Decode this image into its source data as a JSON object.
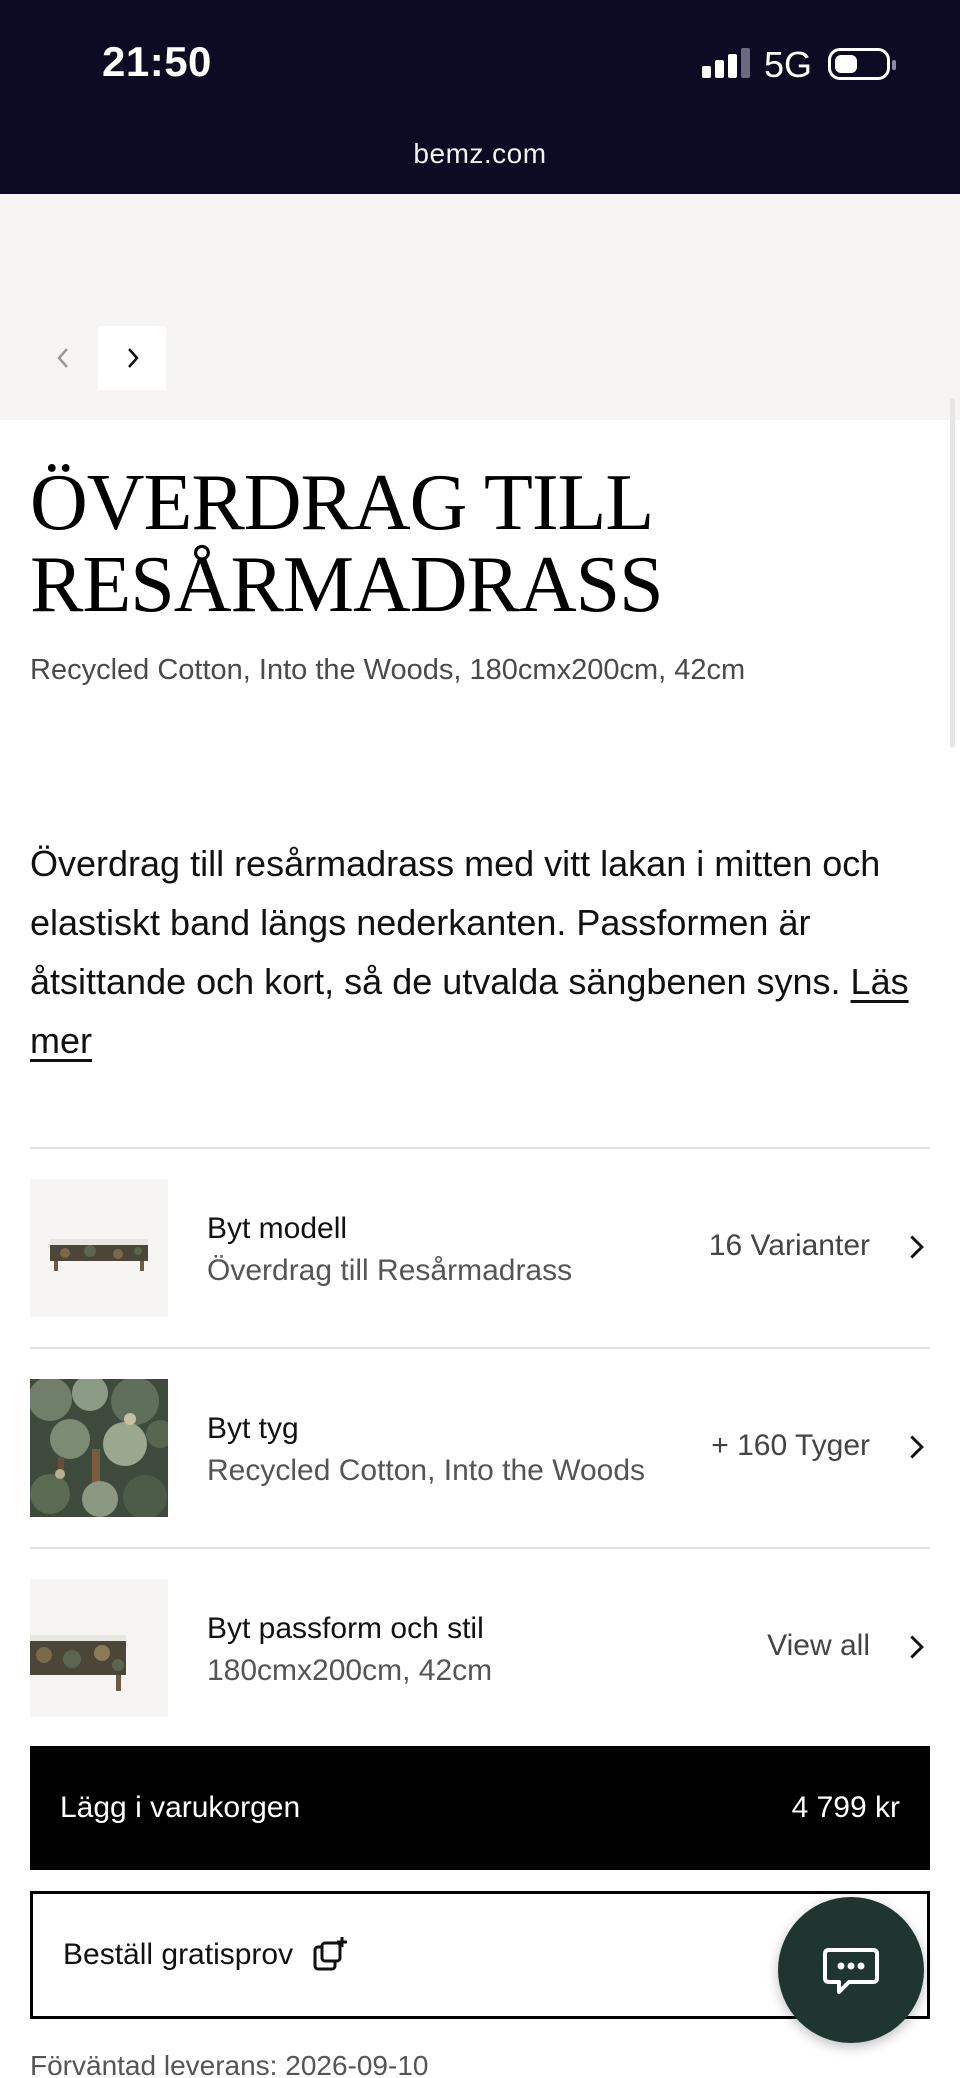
{
  "status_bar": {
    "time": "21:50",
    "network": "5G",
    "url": "bemz.com"
  },
  "gallery": {
    "prev_icon": "chevron-left-icon",
    "next_icon": "chevron-right-icon"
  },
  "product": {
    "title": "ÖVERDRAG TILL RESÅRMADRASS",
    "subtitle": "Recycled Cotton, Into the Woods, 180cmx200cm, 42cm",
    "description": "Överdrag till resårmadrass med vitt lakan i mitten och elastiskt band längs nederkanten. Passformen är åtsittande och kort, så de utvalda sängbenen syns.",
    "read_more": "Läs mer"
  },
  "options": [
    {
      "title": "Byt modell",
      "value": "Överdrag till Resårmadrass",
      "meta": "16 Varianter"
    },
    {
      "title": "Byt tyg",
      "value": "Recycled Cotton, Into the Woods",
      "meta": "+ 160 Tyger"
    },
    {
      "title": "Byt passform och stil",
      "value": "180cmx200cm, 42cm",
      "meta": "View all"
    }
  ],
  "cart": {
    "label": "Lägg i varukorgen",
    "price": "4 799 kr"
  },
  "sample": {
    "label": "Beställ gratisprov",
    "icon": "add-sample-icon"
  },
  "delivery": "Förväntad leverans: 2026-09-10",
  "chat": {
    "icon": "chat-icon"
  },
  "colors": {
    "status_bar": "#0d0a24",
    "cta": "#000000",
    "chat": "#1f3530",
    "gallery_bg": "#f6f5f3"
  }
}
